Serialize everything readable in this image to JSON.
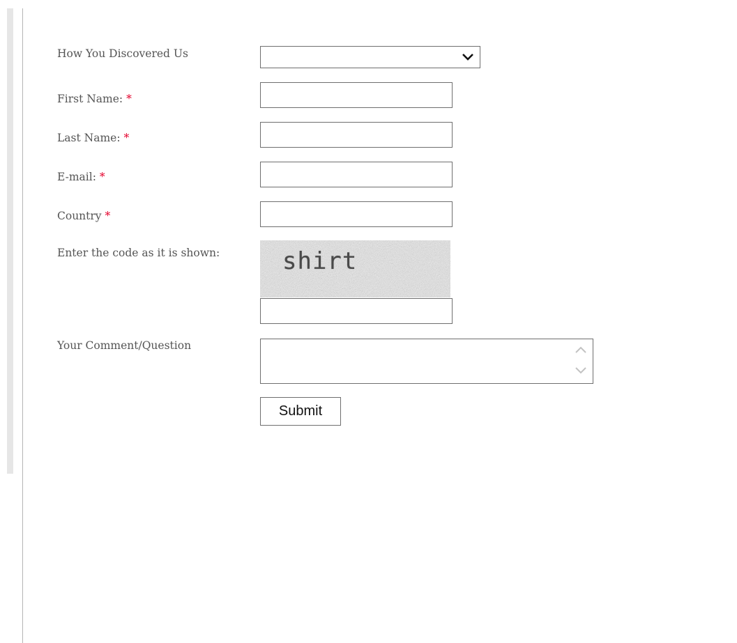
{
  "form": {
    "discovered": {
      "label": "How You Discovered Us",
      "selected_value": "",
      "icon": "chevron-down-icon"
    },
    "first_name": {
      "label": "First Name:",
      "required_mark": "*",
      "value": ""
    },
    "last_name": {
      "label": "Last Name:",
      "required_mark": "*",
      "value": ""
    },
    "email": {
      "label": "E-mail:",
      "required_mark": "*",
      "value": ""
    },
    "country": {
      "label": "Country",
      "required_mark": "*",
      "value": ""
    },
    "captcha": {
      "label": "Enter the code as it is shown:",
      "code": "shirt",
      "value": ""
    },
    "comment": {
      "label": "Your Comment/Question",
      "value": "",
      "scroll_up_icon": "chevron-up-icon",
      "scroll_down_icon": "chevron-down-icon"
    },
    "submit_label": "Submit"
  },
  "colors": {
    "label_text": "#555555",
    "required_mark": "#e4002b",
    "input_border": "#6e6e6e",
    "left_strip": "#e6e6e6"
  }
}
